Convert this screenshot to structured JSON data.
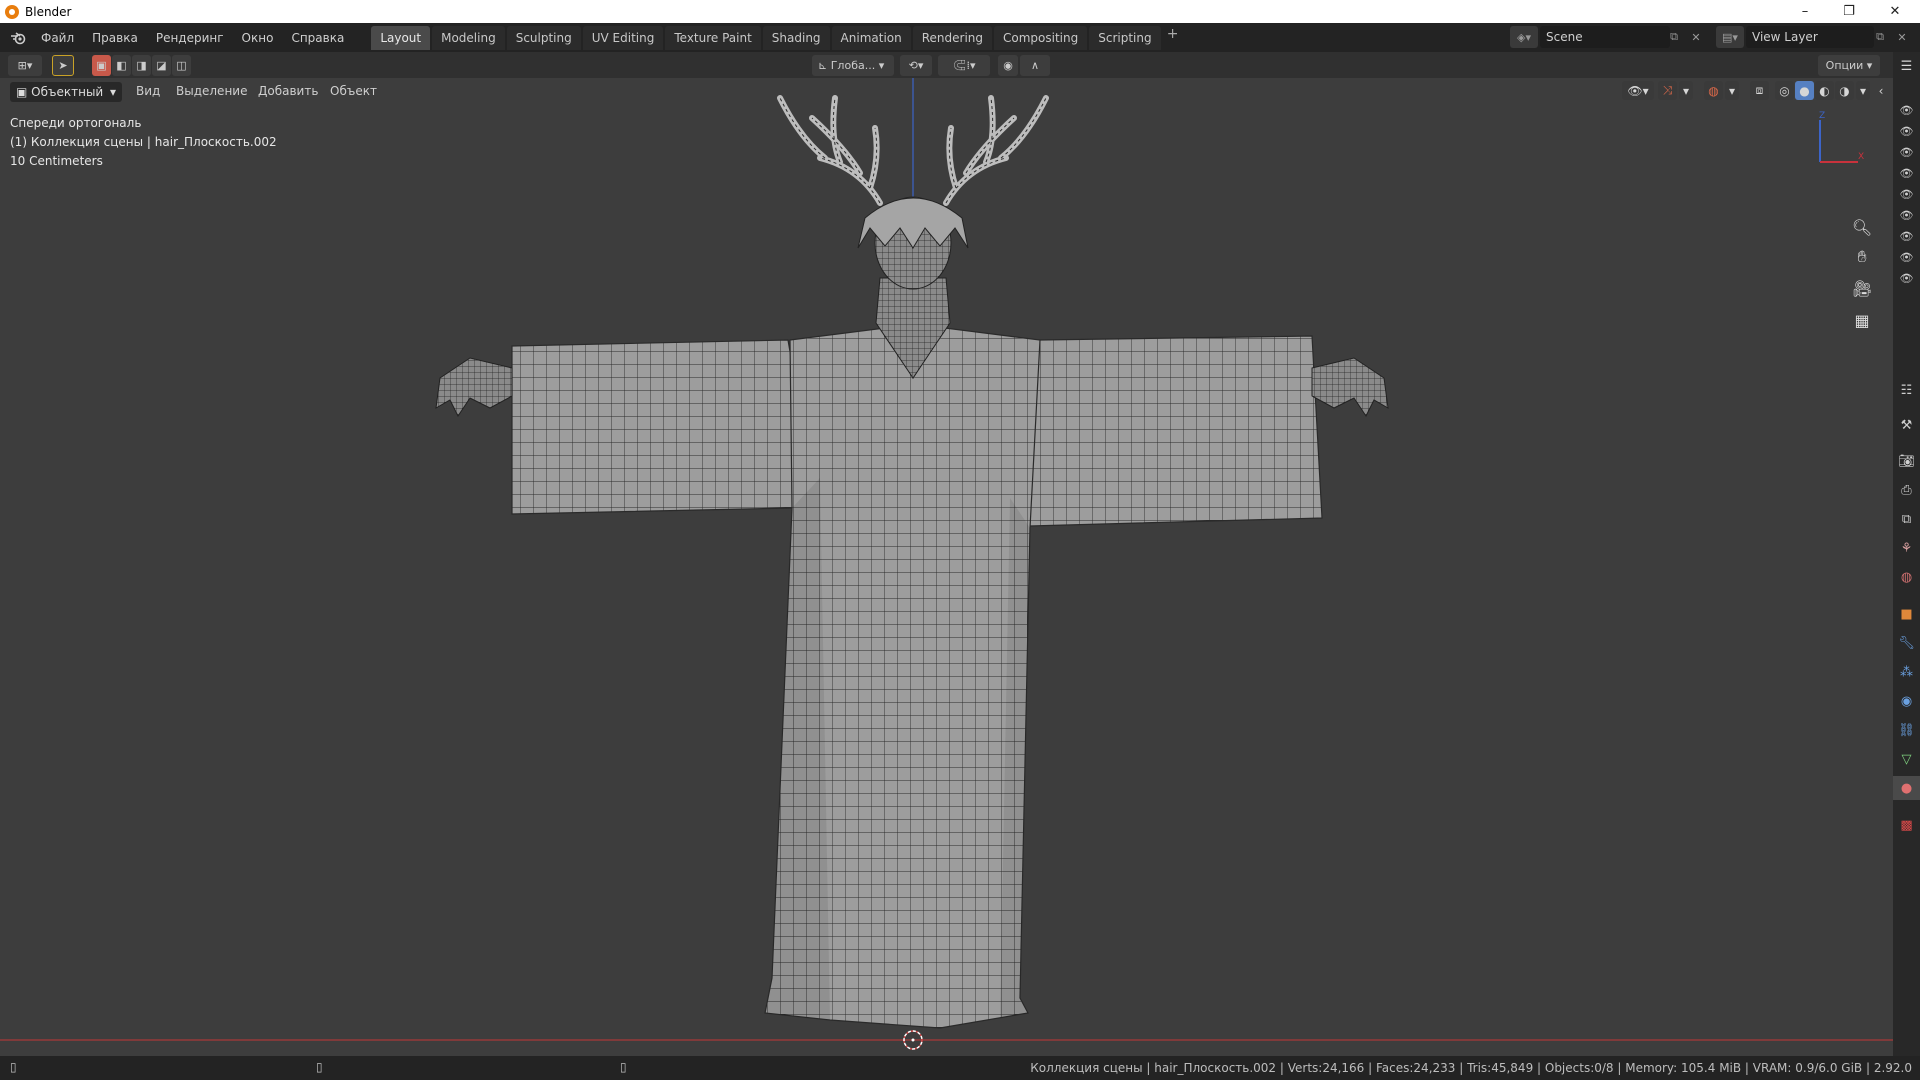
{
  "window": {
    "title": "Blender",
    "minimize": "–",
    "maximize": "❐",
    "close": "✕"
  },
  "menu": [
    "Файл",
    "Правка",
    "Рендеринг",
    "Окно",
    "Справка"
  ],
  "workspaces": [
    "Layout",
    "Modeling",
    "Sculpting",
    "UV Editing",
    "Texture Paint",
    "Shading",
    "Animation",
    "Rendering",
    "Compositing",
    "Scripting"
  ],
  "active_workspace": "Layout",
  "add_workspace": "+",
  "scene": {
    "label": "Scene"
  },
  "view_layer": {
    "label": "View Layer"
  },
  "toolbar": {
    "transform_orientation": "Глоба...",
    "options_label": "Опции"
  },
  "header": {
    "mode": "Объектный",
    "menus": [
      "Вид",
      "Выделение",
      "Добавить",
      "Объект"
    ]
  },
  "viewport_info": {
    "view": "Спереди ортогональ",
    "collection": "(1) Коллекция сцены | hair_Плоскость.002",
    "scale": "10 Centimeters"
  },
  "axes": {
    "z": "Z",
    "x": "X"
  },
  "status": {
    "stats": "Коллекция сцены | hair_Плоскость.002 | Verts:24,166 | Faces:24,233 | Tris:45,849 | Objects:0/8 | Memory: 105.4 MiB | VRAM: 0.9/6.0 GiB | 2.92.0"
  },
  "colors": {
    "accent": "#5680c2",
    "viewport_bg": "#3d3d3d",
    "header_bg": "#232323",
    "x_axis": "#c8323c",
    "z_axis": "#3c64c8"
  }
}
